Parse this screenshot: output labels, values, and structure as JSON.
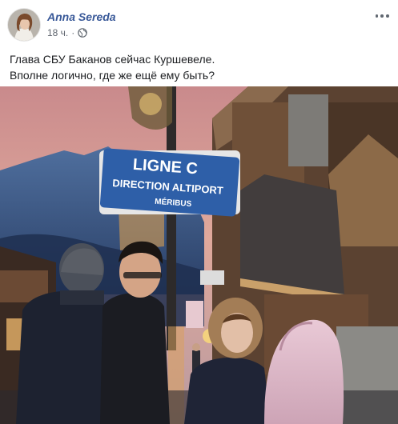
{
  "post": {
    "author": "Anna Sereda",
    "time": "18 ч.",
    "separator": "·",
    "privacy_icon": "globe-icon",
    "more_icon": "more-options-icon",
    "text_lines": [
      "Глава СБУ Баканов сейчас Куршевеле.",
      "Вполне логично, где же ещё ему быть?"
    ]
  },
  "photo": {
    "sign": {
      "line1": "LIGNE C",
      "line2": "DIRECTION ALTIPORT",
      "line3": "MÉRIBUS"
    }
  },
  "colors": {
    "author_link": "#385898",
    "meta_text": "#616770",
    "sign_blue": "#2e5fa8"
  }
}
